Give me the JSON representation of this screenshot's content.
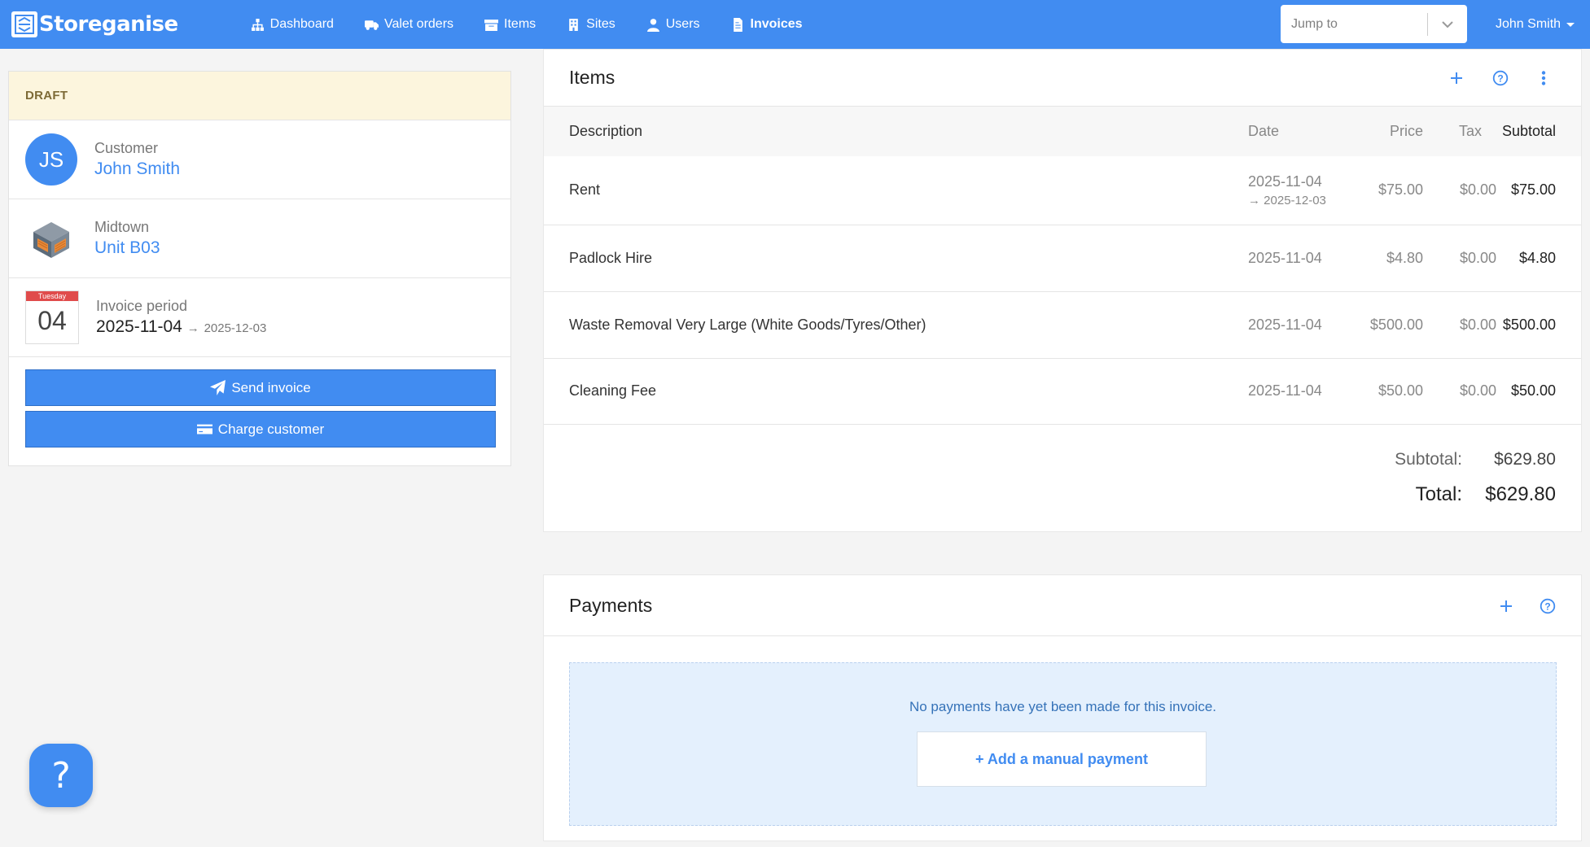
{
  "brand": {
    "name": "Storeganise"
  },
  "nav": {
    "items": [
      {
        "label": "Dashboard",
        "icon": "sitemap-icon"
      },
      {
        "label": "Valet orders",
        "icon": "truck-icon"
      },
      {
        "label": "Items",
        "icon": "archive-icon"
      },
      {
        "label": "Sites",
        "icon": "building-icon"
      },
      {
        "label": "Users",
        "icon": "user-icon"
      },
      {
        "label": "Invoices",
        "icon": "file-invoice-icon",
        "active": true
      }
    ],
    "jump_placeholder": "Jump to",
    "user_name": "John Smith"
  },
  "invoice": {
    "status": "DRAFT",
    "customer_label": "Customer",
    "customer_name": "John Smith",
    "customer_initials": "JS",
    "site_name": "Midtown",
    "unit_name": "Unit B03",
    "cal_weekday": "Tuesday",
    "cal_day": "04",
    "period_label": "Invoice period",
    "period_start": "2025-11-04",
    "period_end": "2025-12-03",
    "send_label": "Send invoice",
    "charge_label": "Charge customer"
  },
  "items_card": {
    "title": "Items",
    "columns": {
      "description": "Description",
      "date": "Date",
      "price": "Price",
      "tax": "Tax",
      "subtotal": "Subtotal"
    },
    "rows": [
      {
        "description": "Rent",
        "date": "2025-11-04",
        "date_to": "2025-12-03",
        "price": "$75.00",
        "tax": "$0.00",
        "subtotal": "$75.00"
      },
      {
        "description": "Padlock Hire",
        "date": "2025-11-04",
        "date_to": "",
        "price": "$4.80",
        "tax": "$0.00",
        "subtotal": "$4.80"
      },
      {
        "description": "Waste Removal Very Large (White Goods/Tyres/Other)",
        "date": "2025-11-04",
        "date_to": "",
        "price": "$500.00",
        "tax": "$0.00",
        "subtotal": "$500.00"
      },
      {
        "description": "Cleaning Fee",
        "date": "2025-11-04",
        "date_to": "",
        "price": "$50.00",
        "tax": "$0.00",
        "subtotal": "$50.00"
      }
    ],
    "subtotal_label": "Subtotal:",
    "subtotal_value": "$629.80",
    "total_label": "Total:",
    "total_value": "$629.80"
  },
  "payments_card": {
    "title": "Payments",
    "empty_text": "No payments have yet been made for this invoice.",
    "add_label": "+ Add a manual payment"
  },
  "help": {
    "label": "?"
  },
  "colors": {
    "primary": "#418cf1",
    "draft_bg": "#fcf5dd",
    "calendar_red": "#e04b4b"
  }
}
